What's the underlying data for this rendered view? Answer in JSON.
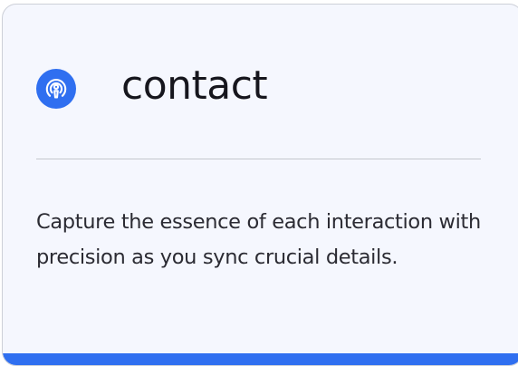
{
  "card": {
    "icon": "podcast-broadcast-icon",
    "title": "contact",
    "description": "Capture the essence of each interaction with precision as you sync crucial details."
  },
  "colors": {
    "accent": "#2f6ff0",
    "card_background": "#f5f7fe",
    "title_text": "#16161d",
    "body_text": "#2b2b33",
    "divider": "#c4c7cd"
  }
}
